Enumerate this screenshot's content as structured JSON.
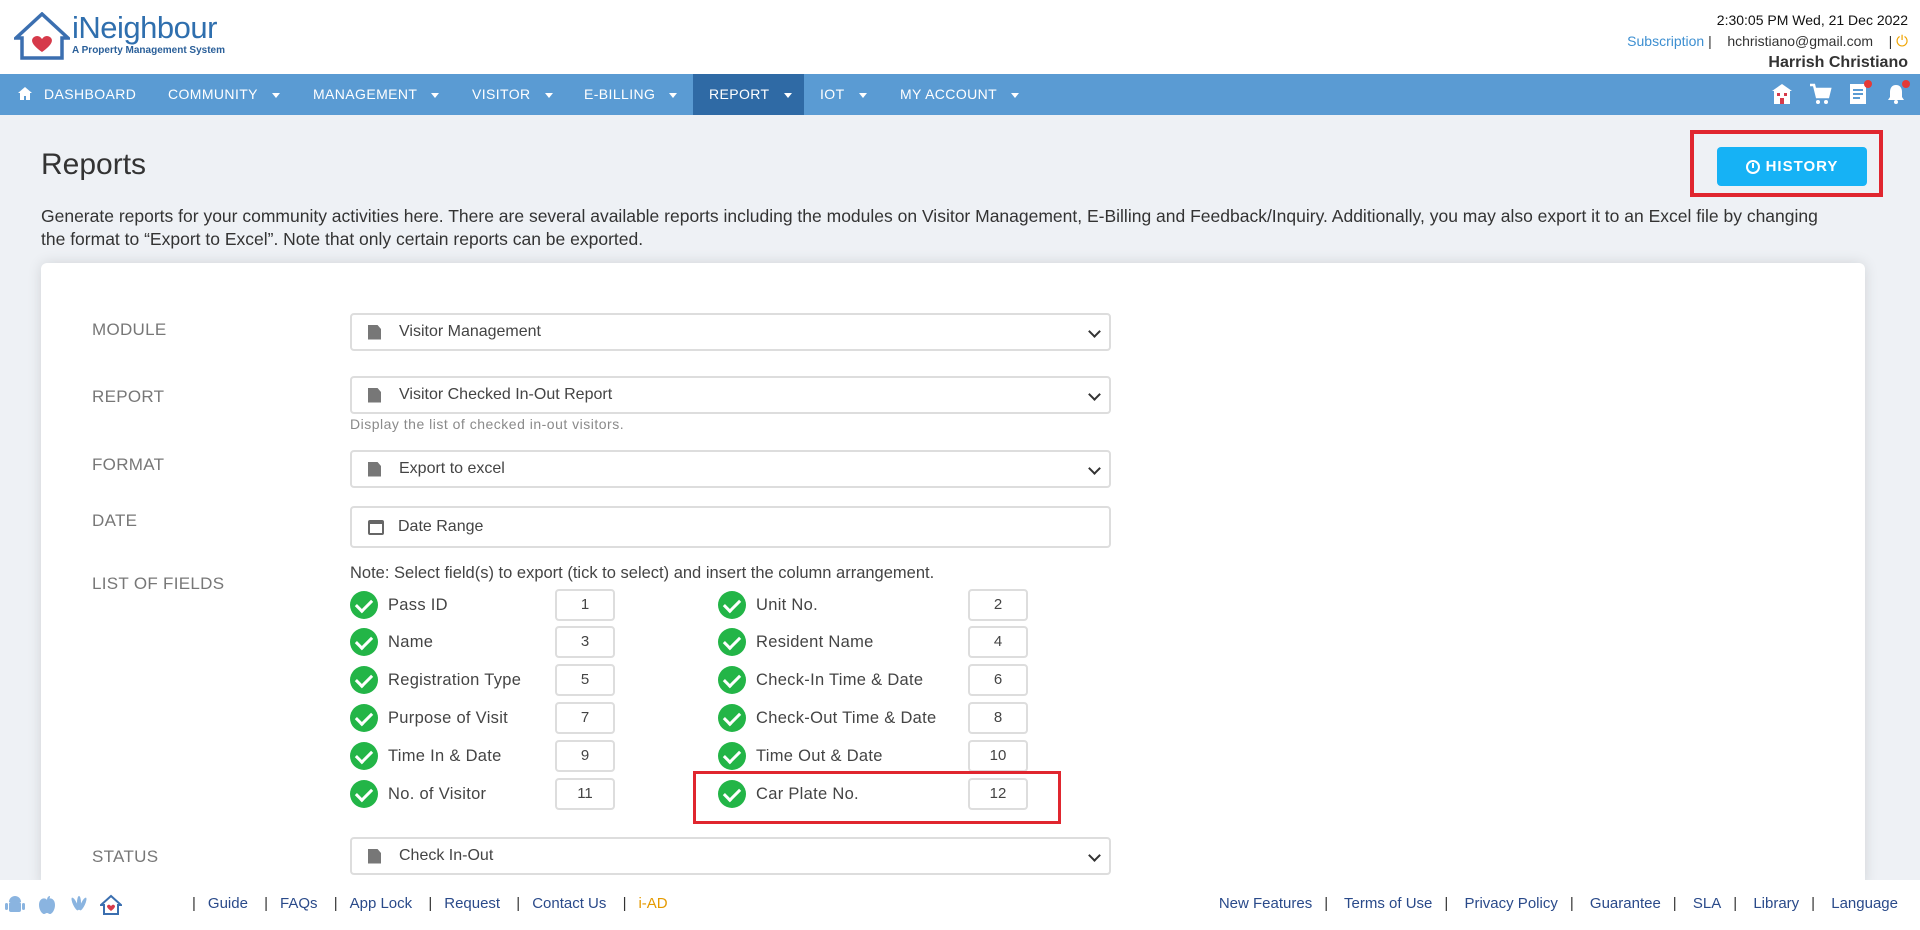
{
  "header": {
    "logo_name": "iNeighbour",
    "logo_tagline": "A Property Management System",
    "datetime": "2:30:05 PM  Wed, 21 Dec 2022",
    "subscription": "Subscription",
    "email": "hchristiano@gmail.com",
    "user_name": "Harrish Christiano"
  },
  "nav": {
    "items": [
      {
        "label": "DASHBOARD",
        "icon": "home-icon"
      },
      {
        "label": "COMMUNITY"
      },
      {
        "label": "MANAGEMENT"
      },
      {
        "label": "VISITOR"
      },
      {
        "label": "E-BILLING"
      },
      {
        "label": "REPORT",
        "active": true
      },
      {
        "label": "IOT"
      },
      {
        "label": "MY ACCOUNT"
      }
    ],
    "right_icons": [
      "building-icon",
      "cart-icon",
      "list-icon",
      "bell-icon"
    ]
  },
  "page": {
    "title": "Reports",
    "history_label": "HISTORY",
    "description": "Generate reports for your community activities here. There are several available reports including the modules on Visitor Management, E-Billing and Feedback/Inquiry. Additionally, you may also export it to an Excel file by changing the format to “Export to Excel”. Note that only certain reports can be exported."
  },
  "form": {
    "module_label": "MODULE",
    "module_value": "Visitor Management",
    "report_label": "REPORT",
    "report_value": "Visitor Checked In-Out Report",
    "report_hint": "Display the list of checked in-out visitors.",
    "format_label": "FORMAT",
    "format_value": "Export to excel",
    "date_label": "DATE",
    "date_placeholder": "Date Range",
    "fields_label": "LIST OF FIELDS",
    "fields_note": "Note: Select field(s) to export (tick to select) and insert the column arrangement.",
    "fields": [
      {
        "name": "Pass ID",
        "order": "1"
      },
      {
        "name": "Unit No.",
        "order": "2"
      },
      {
        "name": "Name",
        "order": "3"
      },
      {
        "name": "Resident Name",
        "order": "4"
      },
      {
        "name": "Registration Type",
        "order": "5"
      },
      {
        "name": "Check-In Time & Date",
        "order": "6"
      },
      {
        "name": "Purpose of Visit",
        "order": "7"
      },
      {
        "name": "Check-Out Time & Date",
        "order": "8"
      },
      {
        "name": "Time In & Date",
        "order": "9"
      },
      {
        "name": "Time Out & Date",
        "order": "10"
      },
      {
        "name": "No. of Visitor",
        "order": "11"
      },
      {
        "name": "Car Plate No.",
        "order": "12"
      }
    ],
    "status_label": "STATUS",
    "status_value": "Check In-Out"
  },
  "footer": {
    "app_icons": [
      "android-icon",
      "apple-icon",
      "huawei-icon",
      "ineighbour-icon"
    ],
    "left_links": [
      "Guide",
      "FAQs",
      "App Lock",
      "Request",
      "Contact Us",
      "i-AD"
    ],
    "right_links": [
      "New Features",
      "Terms of Use",
      "Privacy Policy",
      "Guarantee",
      "SLA",
      "Library",
      "Language"
    ]
  },
  "colors": {
    "nav_bg": "#5a9bd3",
    "nav_active": "#2f6aa5",
    "history_btn": "#16b2f5",
    "check_green": "#23b547",
    "highlight_red": "#e0262f"
  }
}
